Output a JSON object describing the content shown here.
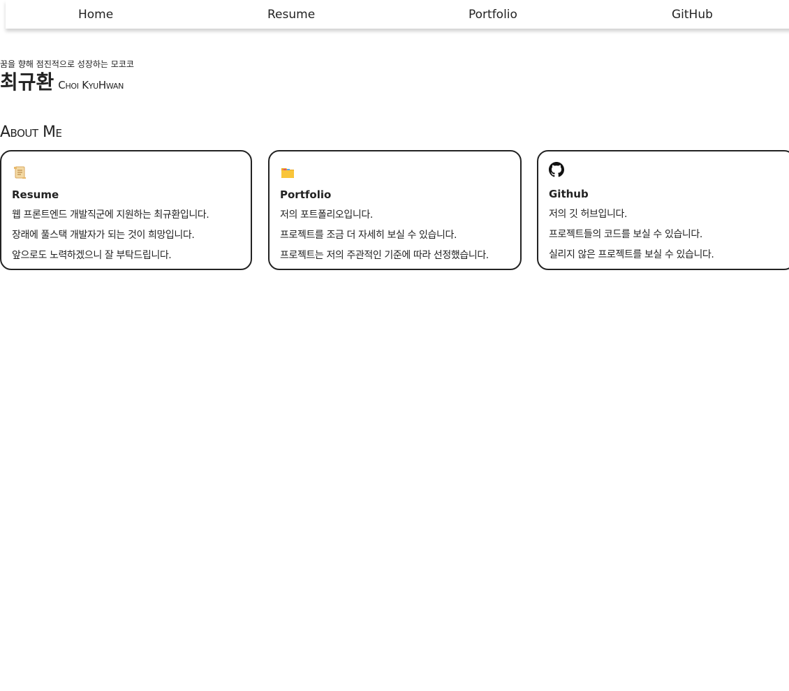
{
  "nav": {
    "items": [
      {
        "label": "Home"
      },
      {
        "label": "Resume"
      },
      {
        "label": "Portfolio"
      },
      {
        "label": "GitHub"
      }
    ]
  },
  "header": {
    "subtitle": "꿈을 향해 점진적으로 성장하는 모코코",
    "name_ko": "최규환",
    "name_en": "Choi KyuHwan"
  },
  "about": {
    "title": "About Me",
    "cards": [
      {
        "icon": "scroll-icon",
        "title": "Resume",
        "lines": [
          "웹 프론트엔드 개발직군에 지원하는 최규환입니다.",
          "장래에 풀스택 개발자가 되는 것이 희망입니다.",
          "앞으로도 노력하겠으니 잘 부탁드립니다."
        ]
      },
      {
        "icon": "folder-icon",
        "title": "Portfolio",
        "lines": [
          "저의 포트폴리오입니다.",
          "프로젝트를 조금 더 자세히 보실 수 있습니다.",
          "프로젝트는 저의 주관적인 기준에 따라 선정했습니다."
        ]
      },
      {
        "icon": "github-icon",
        "title": "Github",
        "lines": [
          "저의 깃 허브입니다.",
          "프로젝트들의 코드를 보실 수 있습니다.",
          "실리지 않은 프로젝트를 보실 수 있습니다."
        ]
      }
    ]
  },
  "colors": {
    "text": "#222222",
    "border": "#222222",
    "folder_yellow": "#f9c53a",
    "scroll_beige": "#f3d9a4"
  }
}
